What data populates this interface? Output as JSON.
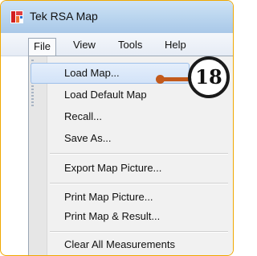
{
  "window": {
    "title": "Tek RSA Map",
    "icon": "app-logo-icon"
  },
  "menubar": {
    "items": [
      {
        "label": "File"
      },
      {
        "label": "View"
      },
      {
        "label": "Tools"
      },
      {
        "label": "Help"
      }
    ]
  },
  "file_menu": {
    "items": [
      {
        "label": "Load Map..."
      },
      {
        "label": "Load Default Map"
      },
      {
        "label": "Recall..."
      },
      {
        "label": "Save As..."
      },
      {
        "label": "Export Map Picture..."
      },
      {
        "label": "Print Map Picture..."
      },
      {
        "label": "Print Map & Result..."
      },
      {
        "label": "Clear All Measurements"
      }
    ],
    "highlighted_item": "Load Map..."
  },
  "callout": {
    "number": "18",
    "color": "#c35a1c"
  }
}
